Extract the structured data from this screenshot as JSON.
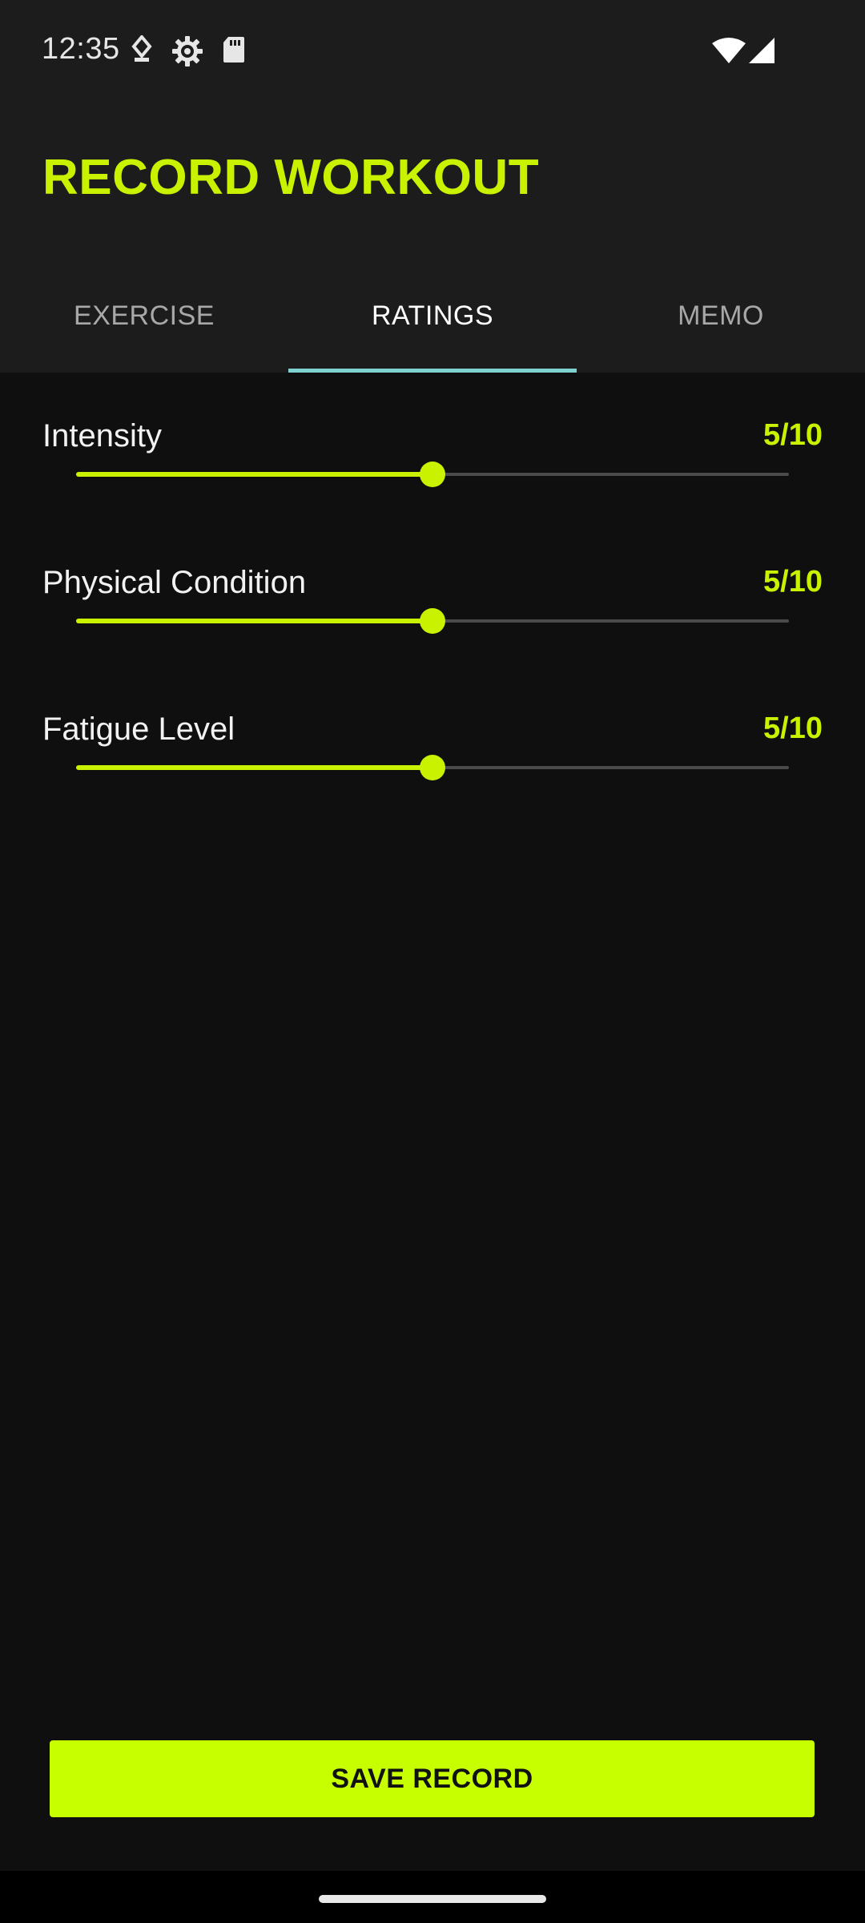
{
  "status_bar": {
    "time": "12:35",
    "icons": [
      "location-icon",
      "settings-gear-icon",
      "sd-card-icon",
      "wifi-icon",
      "cell-signal-icon"
    ]
  },
  "header": {
    "title": "RECORD WORKOUT"
  },
  "tabs": [
    {
      "label": "EXERCISE",
      "active": false
    },
    {
      "label": "RATINGS",
      "active": true
    },
    {
      "label": "MEMO",
      "active": false
    }
  ],
  "ratings": [
    {
      "label": "Intensity",
      "value_text": "5/10",
      "value": 5,
      "max": 10
    },
    {
      "label": "Physical Condition",
      "value_text": "5/10",
      "value": 5,
      "max": 10
    },
    {
      "label": "Fatigue Level",
      "value_text": "5/10",
      "value": 5,
      "max": 10
    }
  ],
  "save_button": {
    "label": "SAVE RECORD"
  },
  "colors": {
    "accent": "#c8f200",
    "button": "#c8ff00",
    "tab_indicator": "#7fd2cf",
    "header_bg": "#1c1c1c",
    "body_bg": "#0f0f0f"
  }
}
